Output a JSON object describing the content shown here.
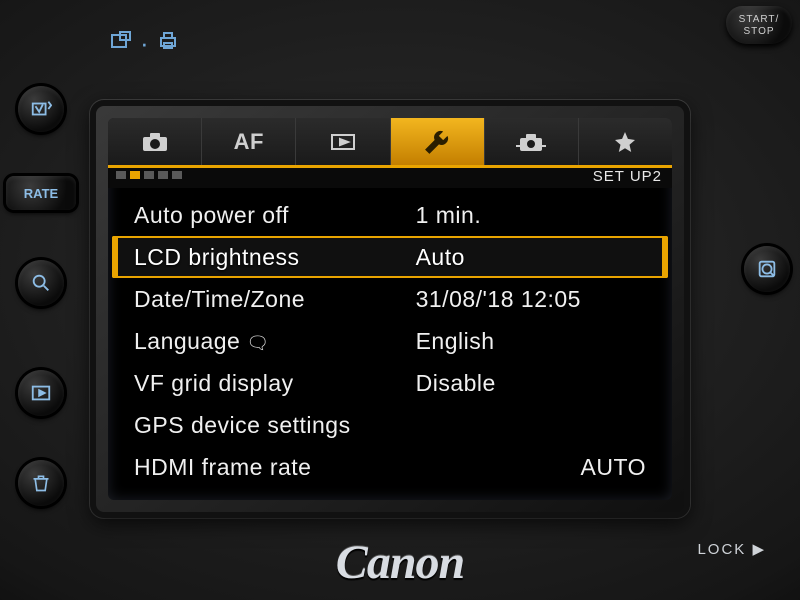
{
  "brand": "Canon",
  "lock_label": "LOCK ▶",
  "start_stop_label": "START/\nSTOP",
  "tabs": {
    "items": [
      "camera-icon",
      "AF",
      "playback-icon",
      "wrench-icon",
      "custom-fn-icon",
      "star-icon"
    ],
    "active_index": 3,
    "sub_pages_total": 5,
    "sub_page_index": 1,
    "page_label": "SET UP2"
  },
  "menu": {
    "selected_index": 1,
    "rows": [
      {
        "label": "Auto power off",
        "value": "1 min."
      },
      {
        "label": "LCD brightness",
        "value": "Auto"
      },
      {
        "label": "Date/Time/Zone",
        "value": "31/08/'18 12:05"
      },
      {
        "label": "Language",
        "value": "English",
        "has_lang_icon": true
      },
      {
        "label": "VF grid display",
        "value": "Disable"
      },
      {
        "label": "GPS device settings",
        "value": ""
      },
      {
        "label": "HDMI frame rate",
        "value": "AUTO"
      }
    ]
  },
  "hardware": {
    "rate_button_label": "RATE"
  }
}
